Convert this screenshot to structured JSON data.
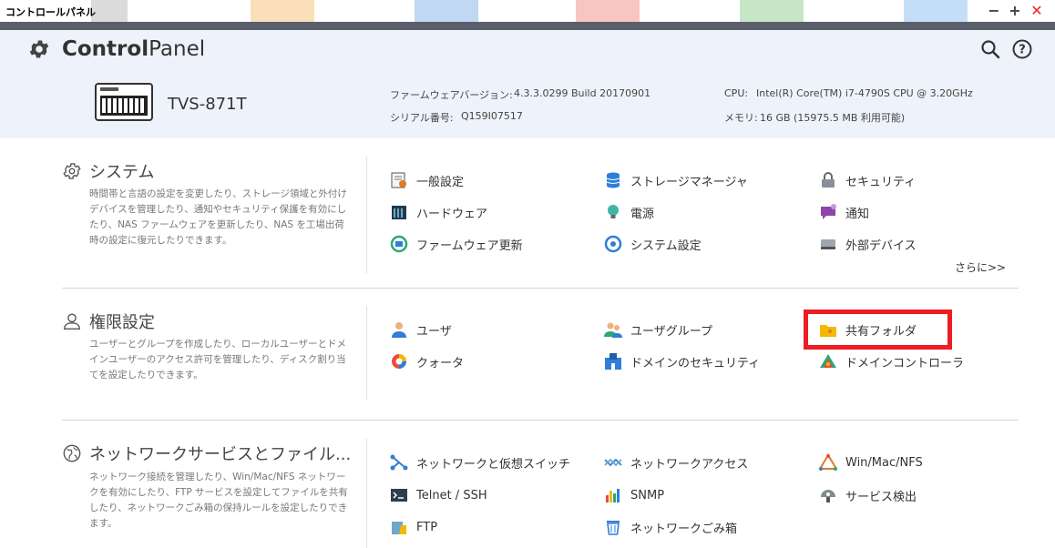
{
  "window": {
    "title": "コントロールパネル"
  },
  "header": {
    "brand_bold": "Control",
    "brand_light": "Panel",
    "device_name": "TVS-871T",
    "firmware_label": "ファームウェアバージョン:",
    "firmware_value": "4.3.3.0299 Build 20170901",
    "serial_label": "シリアル番号:",
    "serial_value": "Q159I07517",
    "cpu_label": "CPU:",
    "cpu_value": "Intel(R) Core(TM) i7-4790S CPU @ 3.20GHz",
    "memory_label": "メモリ:",
    "memory_value": "16 GB (15975.5 MB 利用可能)"
  },
  "sections": {
    "system": {
      "title": "システム",
      "desc": "時間帯と言語の設定を変更したり、ストレージ領域と外付けデバイスを管理したり、通知やセキュリティ保護を有効にしたり、NAS ファームウェアを更新したり、NAS を工場出荷時の設定に復元したりできます。",
      "items": [
        {
          "label": "一般設定"
        },
        {
          "label": "ストレージマネージャ"
        },
        {
          "label": "セキュリティ"
        },
        {
          "label": "ハードウェア"
        },
        {
          "label": "電源"
        },
        {
          "label": "通知"
        },
        {
          "label": "ファームウェア更新"
        },
        {
          "label": "システム設定"
        },
        {
          "label": "外部デバイス"
        }
      ],
      "more": "さらに>>"
    },
    "privilege": {
      "title": "権限設定",
      "desc": "ユーザーとグループを作成したり、ローカルユーザーとドメインユーザーのアクセス許可を管理したり、ディスク割り当てを設定したりできます。",
      "items": [
        {
          "label": "ユーザ"
        },
        {
          "label": "ユーザグループ"
        },
        {
          "label": "共有フォルダ"
        },
        {
          "label": "クォータ"
        },
        {
          "label": "ドメインのセキュリティ"
        },
        {
          "label": "ドメインコントローラ"
        }
      ]
    },
    "network": {
      "title": "ネットワークサービスとファイル...",
      "desc": "ネットワーク接続を管理したり、Win/Mac/NFS ネットワークを有効にしたり、FTP サービスを設定してファイルを共有したり、ネットワークごみ箱の保持ルールを設定したりできます。",
      "items": [
        {
          "label": "ネットワークと仮想スイッチ"
        },
        {
          "label": "ネットワークアクセス"
        },
        {
          "label": "Win/Mac/NFS"
        },
        {
          "label": "Telnet / SSH"
        },
        {
          "label": "SNMP"
        },
        {
          "label": "サービス検出"
        },
        {
          "label": "FTP"
        },
        {
          "label": "ネットワークごみ箱"
        }
      ]
    }
  },
  "colors": {
    "highlight": "#ef1c24",
    "header_bg": "#eef3fb",
    "topline": "#5b5e6b"
  }
}
